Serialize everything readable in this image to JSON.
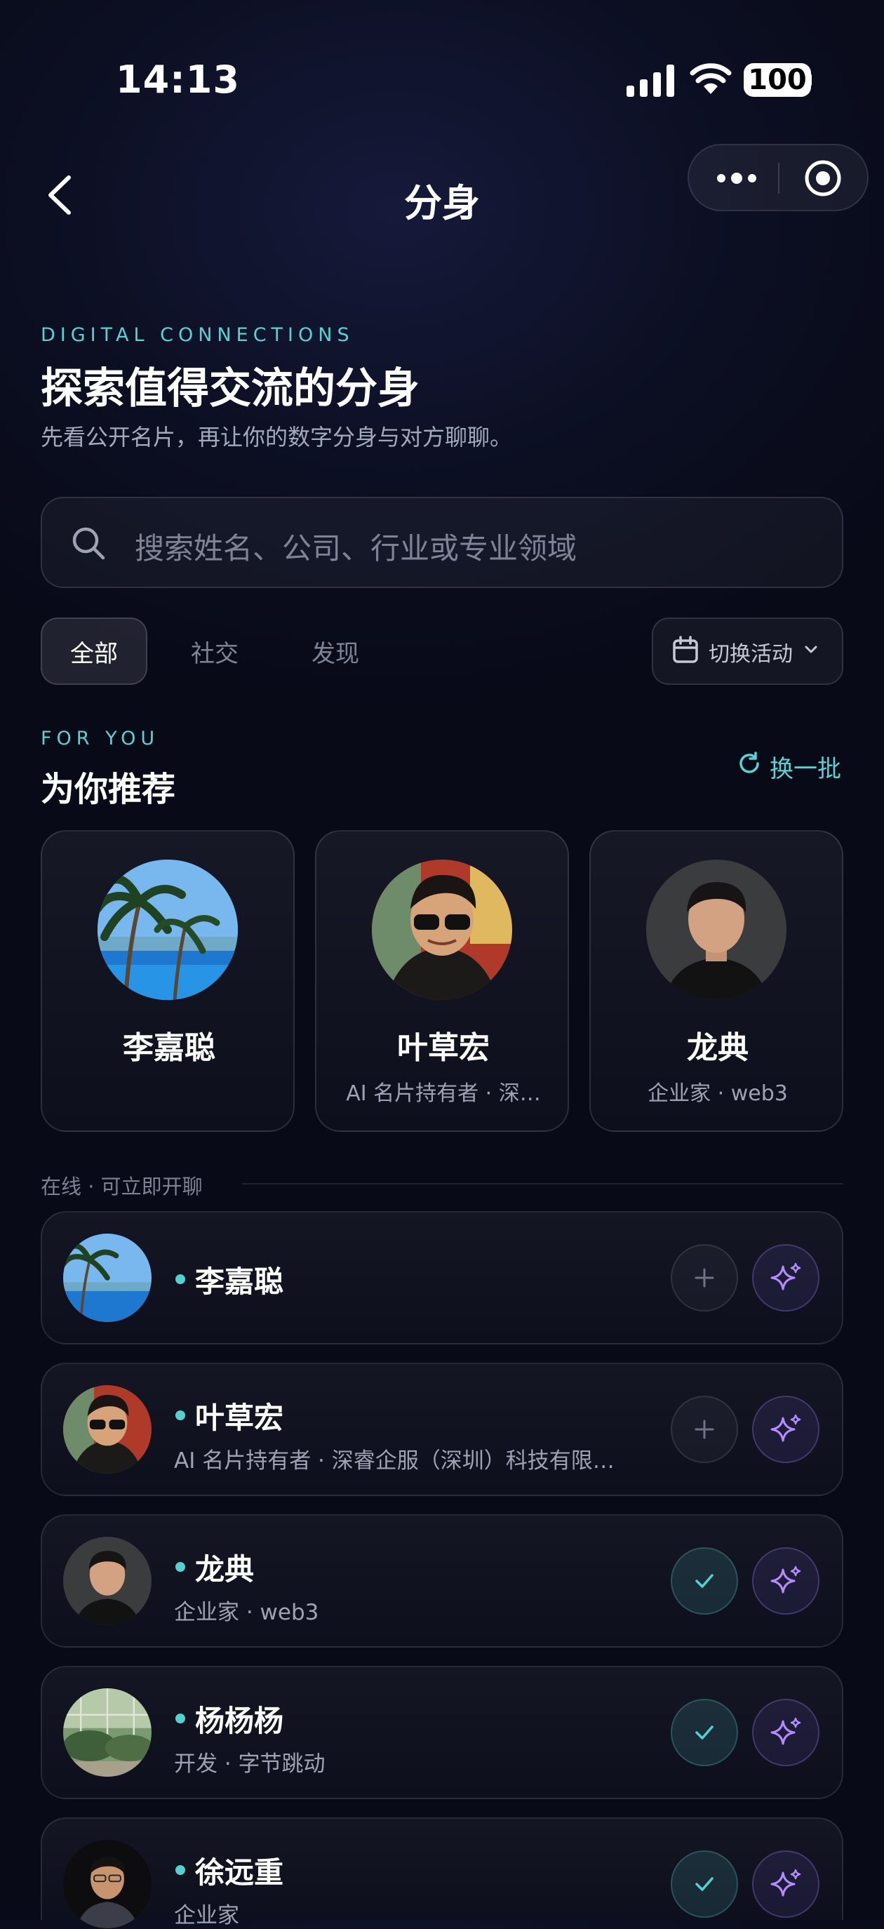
{
  "status_bar": {
    "time": "14:13",
    "battery": "100"
  },
  "nav": {
    "title": "分身"
  },
  "header": {
    "eyebrow": "DIGITAL CONNECTIONS",
    "title": "探索值得交流的分身",
    "subtitle": "先看公开名片，再让你的数字分身与对方聊聊。"
  },
  "search": {
    "placeholder": "搜索姓名、公司、行业或专业领域"
  },
  "tabs": [
    {
      "label": "全部",
      "active": true
    },
    {
      "label": "社交",
      "active": false
    },
    {
      "label": "发现",
      "active": false
    }
  ],
  "switch_activity": {
    "label": "切换活动"
  },
  "recommend": {
    "eyebrow": "FOR YOU",
    "title": "为你推荐",
    "refresh_label": "换一批",
    "cards": [
      {
        "name": "李嘉聪",
        "meta": ""
      },
      {
        "name": "叶草宏",
        "meta": "AI 名片持有者 · 深…"
      },
      {
        "name": "龙典",
        "meta": "企业家 · web3"
      }
    ]
  },
  "online": {
    "section_label": "在线 · 可立即开聊",
    "items": [
      {
        "name": "李嘉聪",
        "meta": "",
        "status": "add"
      },
      {
        "name": "叶草宏",
        "meta": "AI 名片持有者 · 深睿企服（深圳）科技有限…",
        "status": "add"
      },
      {
        "name": "龙典",
        "meta": "企业家 · web3",
        "status": "added"
      },
      {
        "name": "杨杨杨",
        "meta": "开发 · 字节跳动",
        "status": "added"
      },
      {
        "name": "徐远重",
        "meta": "企业家",
        "status": "added"
      }
    ]
  },
  "colors": {
    "accent": "#59d2d4",
    "sparkle": "#b48cff",
    "background": "#0c0f22"
  }
}
